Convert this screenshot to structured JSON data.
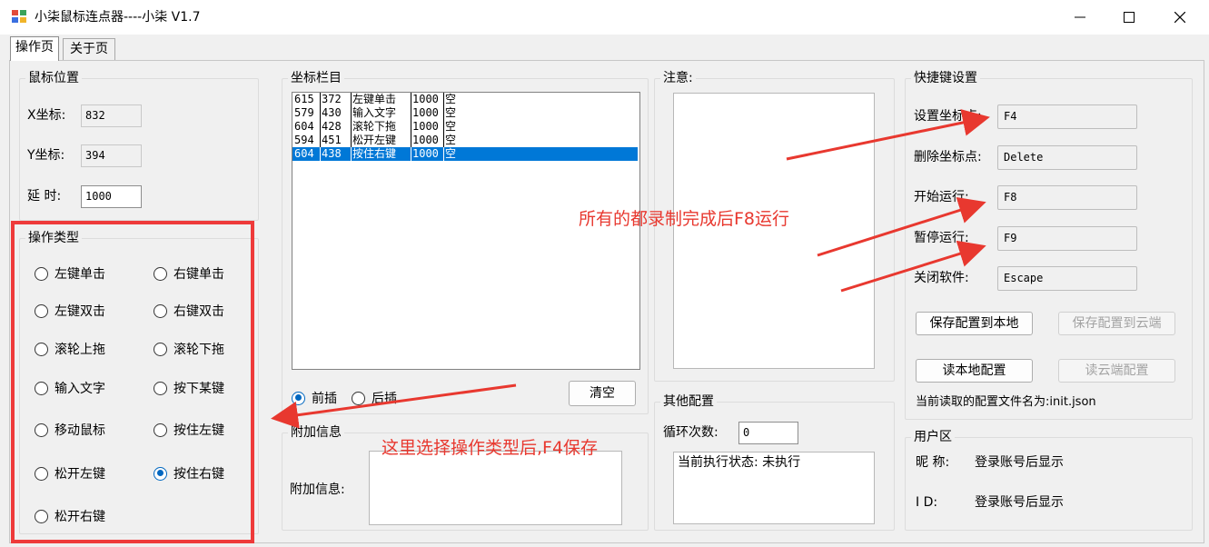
{
  "window": {
    "title": "小柒鼠标连点器----小柒 V1.7",
    "minimize_icon": "minimize-icon",
    "maximize_icon": "maximize-icon",
    "close_icon": "close-icon"
  },
  "tabs": [
    {
      "label": "操作页"
    },
    {
      "label": "关于页"
    }
  ],
  "mouse_pos": {
    "title": "鼠标位置",
    "x_label": "X坐标:",
    "x_value": "832",
    "y_label": "Y坐标:",
    "y_value": "394",
    "delay_label": "延 时:",
    "delay_value": "1000"
  },
  "op_type": {
    "title": "操作类型",
    "options": [
      {
        "label": "左键单击",
        "checked": false
      },
      {
        "label": "右键单击",
        "checked": false
      },
      {
        "label": "左键双击",
        "checked": false
      },
      {
        "label": "右键双击",
        "checked": false
      },
      {
        "label": "滚轮上拖",
        "checked": false
      },
      {
        "label": "滚轮下拖",
        "checked": false
      },
      {
        "label": "输入文字",
        "checked": false
      },
      {
        "label": "按下某键",
        "checked": false
      },
      {
        "label": "移动鼠标",
        "checked": false
      },
      {
        "label": "按住左键",
        "checked": false
      },
      {
        "label": "松开左键",
        "checked": false
      },
      {
        "label": "按住右键",
        "checked": true
      },
      {
        "label": "松开右键",
        "checked": false
      }
    ]
  },
  "coord_bar": {
    "title": "坐标栏目",
    "rows": [
      {
        "x": "615",
        "y": "372",
        "action": "左键单击",
        "delay": "1000",
        "text": "空",
        "selected": false
      },
      {
        "x": "579",
        "y": "430",
        "action": "输入文字",
        "delay": "1000",
        "text": "空",
        "selected": false
      },
      {
        "x": "604",
        "y": "428",
        "action": "滚轮下拖",
        "delay": "1000",
        "text": "空",
        "selected": false
      },
      {
        "x": "594",
        "y": "451",
        "action": "松开左键",
        "delay": "1000",
        "text": "空",
        "selected": false
      },
      {
        "x": "604",
        "y": "438",
        "action": "按住右键",
        "delay": "1000",
        "text": "空",
        "selected": true
      }
    ],
    "insert_before": "前插",
    "insert_after": "后插",
    "clear_label": "清空"
  },
  "extra_info": {
    "title": "附加信息",
    "label": "附加信息:"
  },
  "notice": {
    "title": "注意:"
  },
  "other_config": {
    "title": "其他配置",
    "loop_label": "循环次数:",
    "loop_value": "0",
    "status_text": "当前执行状态: 未执行"
  },
  "hotkeys": {
    "title": "快捷键设置",
    "set_point_label": "设置坐标点:",
    "set_point_key": "F4",
    "delete_point_label": "删除坐标点:",
    "delete_point_key": "Delete",
    "start_label": "开始运行:",
    "start_key": "F8",
    "pause_label": "暂停运行:",
    "pause_key": "F9",
    "close_label": "关闭软件:",
    "close_key": "Escape",
    "save_local": "保存配置到本地",
    "save_cloud": "保存配置到云端",
    "read_local": "读本地配置",
    "read_cloud": "读云端配置",
    "config_file": "当前读取的配置文件名为:init.json"
  },
  "user": {
    "title": "用户区",
    "nick_label": "昵 称:",
    "nick_value": "登录账号后显示",
    "id_label": "I D:",
    "id_value": "登录账号后显示"
  },
  "annotations": {
    "run_hint": "所有的都录制完成后F8运行",
    "select_hint": "这里选择操作类型后,F4保存",
    "color": "#e8382f"
  },
  "colors": {
    "accent": "#0078d7",
    "annotation_red": "#e8382f"
  }
}
